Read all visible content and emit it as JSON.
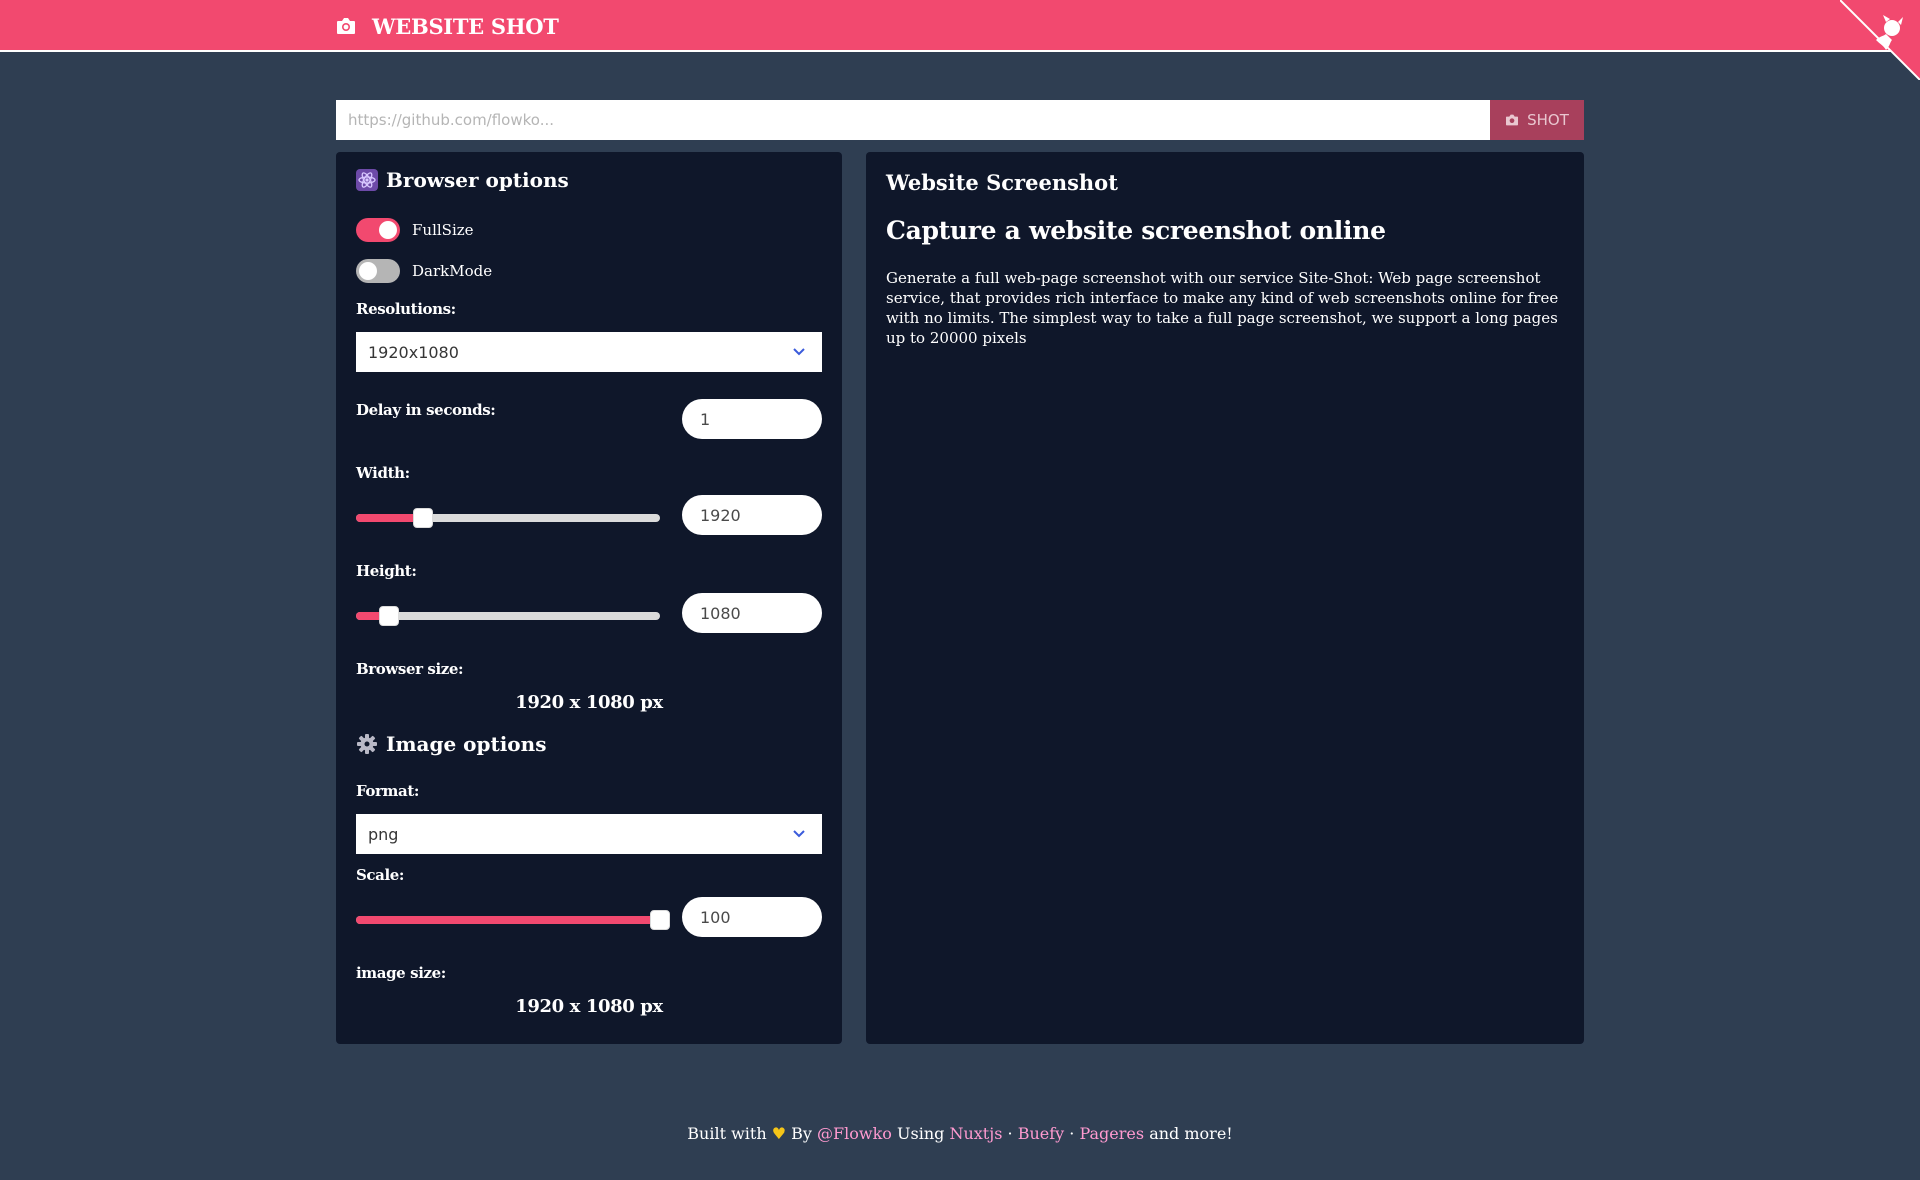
{
  "app": {
    "title": "WEBSITE SHOT"
  },
  "url_bar": {
    "placeholder": "https://github.com/flowko...",
    "shot_label": "SHOT"
  },
  "browser_options": {
    "title": "Browser options",
    "fullsize_label": "FullSize",
    "fullsize_on": true,
    "darkmode_label": "DarkMode",
    "darkmode_on": false,
    "resolutions_label": "Resolutions:",
    "resolution_value": "1920x1080",
    "delay_label": "Delay in seconds:",
    "delay_value": "1",
    "width_label": "Width:",
    "width_value": "1920",
    "width_slider_fraction": 0.22,
    "height_label": "Height:",
    "height_value": "1080",
    "height_slider_fraction": 0.11,
    "browser_size_label": "Browser size:",
    "browser_size_value": "1920 x 1080 px"
  },
  "image_options": {
    "title": "Image options",
    "format_label": "Format:",
    "format_value": "png",
    "scale_label": "Scale:",
    "scale_value": "100",
    "scale_slider_fraction": 1.0,
    "image_size_label": "image size:",
    "image_size_value": "1920 x 1080 px"
  },
  "info": {
    "title": "Website Screenshot",
    "subtitle": "Capture a website screenshot online",
    "paragraph": "Generate a full web-page screenshot with our service Site-Shot: Web page screenshot service, that provides rich interface to make any kind of web screenshots online for free with no limits. The simplest way to take a full page screenshot, we support a long pages up to 20000 pixels"
  },
  "footer": {
    "built_with": "Built with",
    "by": "By",
    "author": "@Flowko",
    "using": "Using",
    "link1": "Nuxtjs",
    "sep1": "·",
    "link2": "Buefy",
    "sep2": "·",
    "link3": "Pageres",
    "more": "and more!"
  },
  "colors": {
    "accent": "#f2496f",
    "page_bg": "#2f3e52",
    "panel_bg": "#0f172a",
    "link": "#ff9ad0"
  },
  "icons": [
    "camera-icon",
    "react-icon",
    "gear-icon",
    "chevron-down-icon",
    "heart-icon",
    "github-icon"
  ]
}
